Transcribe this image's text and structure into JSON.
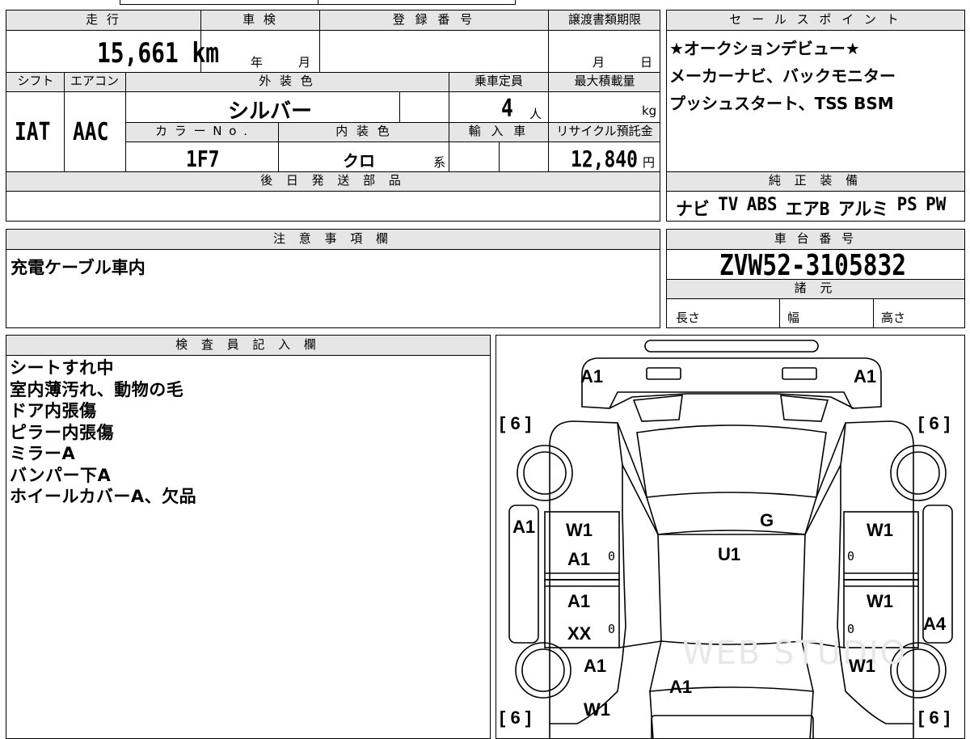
{
  "mileage": {
    "label": "走 行",
    "value": "15,661",
    "unit": "km"
  },
  "inspection": {
    "label": "車 検",
    "year_unit": "年",
    "month_unit": "月"
  },
  "registration": {
    "label": "登 録 番 号"
  },
  "transfer_deadline": {
    "label": "譲渡書類期限",
    "month_unit": "月",
    "day_unit": "日"
  },
  "shift": {
    "label": "シフト",
    "value": "IAT"
  },
  "aircon": {
    "label": "エアコン",
    "value": "AAC"
  },
  "exterior_color": {
    "label": "外 装 色",
    "value": "シルバー"
  },
  "capacity": {
    "label": "乗車定員",
    "value": "4",
    "unit": "人"
  },
  "max_load": {
    "label": "最大積載量",
    "unit": "kg"
  },
  "color_no": {
    "label": "カ ラ ー N o .",
    "value": "1F7"
  },
  "interior_color": {
    "label": "内 装 色",
    "value": "クロ",
    "suffix": "系"
  },
  "import": {
    "label": "輸 入 車"
  },
  "recycle_fee": {
    "label": "リサイクル預託金",
    "value": "12,840",
    "unit": "円"
  },
  "later_parts": {
    "label": "後 日 発 送 部 品"
  },
  "sales_points": {
    "label": "セ ー ル ス ポ イ ン ト",
    "lines": [
      "★オークションデビュー★",
      "メーカーナビ、バックモニター",
      "プッシュスタート、TSS BSM"
    ]
  },
  "genuine_equipment": {
    "label": "純 正 装 備",
    "items": [
      "ナビ",
      "TV",
      "ABS",
      "エアB",
      "アルミ",
      "PS",
      "PW"
    ]
  },
  "caution": {
    "label": "注 意 事 項 欄",
    "text": "充電ケーブル車内"
  },
  "chassis": {
    "label": "車 台 番 号",
    "value": "ZVW52-3105832",
    "specs_label": "諸 元",
    "length_label": "長さ",
    "width_label": "幅",
    "height_label": "高さ"
  },
  "inspector": {
    "label": "検 査 員 記 入 欄",
    "lines": [
      "シートすれ中",
      "室内薄汚れ、動物の毛",
      "ドア内張傷",
      "ピラー内張傷",
      "ミラーA",
      "バンパー下A",
      "ホイールカバーA、欠品"
    ]
  },
  "diagram": {
    "watermark": "WEB STUDIO",
    "brackets": {
      "front_left": "[ 6 ]",
      "front_right": "[ 6 ]",
      "rear_left": "[ 6 ]",
      "rear_right": "[ 6 ]"
    },
    "marks": {
      "front_left": "A1",
      "front_right": "A1",
      "windshield": "G",
      "roof": "U1",
      "left_side": "A1",
      "right_side": "A4",
      "fl_door_1": "W1",
      "fl_door_2": "A1",
      "fl_door_zero": "0",
      "rl_door_1": "A1",
      "rl_door_2": "XX",
      "rl_door_zero": "0",
      "fr_door": "W1",
      "fr_door_zero": "0",
      "rr_door": "W1",
      "rr_door_zero": "0",
      "rear_left_fender": "A1",
      "rear_right_fender": "W1",
      "rear_left_low": "W1",
      "trunk": "A1"
    }
  }
}
